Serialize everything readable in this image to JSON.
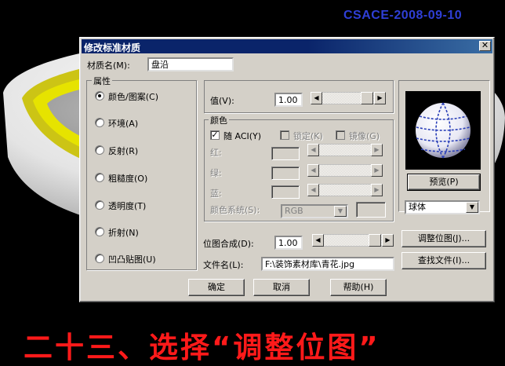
{
  "watermark": "CSACE-2008-09-10",
  "caption": "二十三、选择“调整位图”",
  "dialog": {
    "title": "修改标准材质",
    "close_glyph": "✕",
    "material_name_label": "材质名",
    "material_name_key": "(M):",
    "material_name_value": "盘沿",
    "attributes_title": "属性",
    "attributes": [
      {
        "label": "颜色/图案",
        "key": "(C)",
        "selected": true
      },
      {
        "label": "环境",
        "key": "(A)",
        "selected": false
      },
      {
        "label": "反射",
        "key": "(R)",
        "selected": false
      },
      {
        "label": "粗糙度",
        "key": "(O)",
        "selected": false
      },
      {
        "label": "透明度",
        "key": "(T)",
        "selected": false
      },
      {
        "label": "折射",
        "key": "(N)",
        "selected": false
      },
      {
        "label": "凹凸贴图",
        "key": "(U)",
        "selected": false
      }
    ],
    "value_label": "值",
    "value_key": "(V):",
    "value": "1.00",
    "color_title": "颜色",
    "by_aci_label": "随 ACI",
    "by_aci_key": "(Y)",
    "by_aci_checked": true,
    "lock_label": "锁定",
    "lock_key": "(K)",
    "mirror_label": "镜像",
    "mirror_key": "(G)",
    "red_label": "红:",
    "green_label": "绿:",
    "blue_label": "蓝:",
    "color_system_label": "颜色系统",
    "color_system_key": "(S):",
    "color_system_value": "RGB",
    "bitmap_blend_label": "位图合成",
    "bitmap_blend_key": "(D):",
    "bitmap_blend_value": "1.00",
    "file_name_label": "文件名",
    "file_name_key": "(L):",
    "file_name_value": "F:\\装饰素材库\\青花.jpg",
    "preview_button": "预览(P)",
    "preview_shape": "球体",
    "adjust_bitmap_button": "调整位图(J)...",
    "find_file_button": "查找文件(I)...",
    "ok_button": "确定",
    "cancel_button": "取消",
    "help_button": "帮助(H)"
  }
}
